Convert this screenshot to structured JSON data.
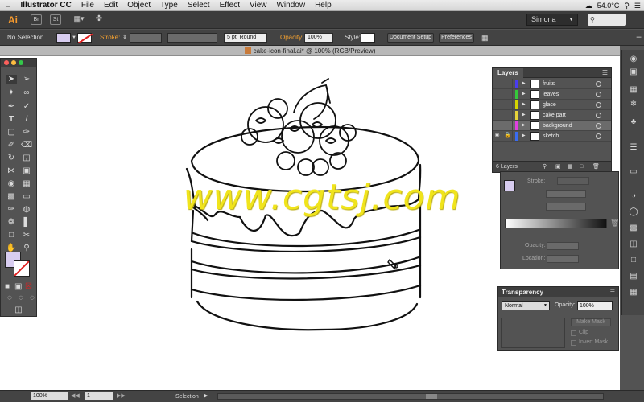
{
  "menubar": {
    "apple": "",
    "app": "Illustrator CC",
    "items": [
      "File",
      "Edit",
      "Object",
      "Type",
      "Select",
      "Effect",
      "View",
      "Window",
      "Help"
    ],
    "temp": "54.0°C"
  },
  "appbar": {
    "logo": "Ai",
    "bridge": "Br",
    "stock": "St",
    "workspace": "Simona"
  },
  "control": {
    "selection": "No Selection",
    "stroke_label": "Stroke:",
    "brush": "5 pt. Round",
    "opacity_label": "Opacity:",
    "opacity": "100%",
    "style_label": "Style:",
    "doc_setup": "Document Setup",
    "preferences": "Preferences"
  },
  "document": {
    "tab_title": "cake-icon-final.ai* @ 100% (RGB/Preview)"
  },
  "layers": {
    "tab": "Layers",
    "count": "6 Layers",
    "items": [
      {
        "name": "fruits",
        "color": "#4a3cf0"
      },
      {
        "name": "leaves",
        "color": "#36c83a"
      },
      {
        "name": "glace",
        "color": "#d4d400"
      },
      {
        "name": "cake part",
        "color": "#e7d33a"
      },
      {
        "name": "background",
        "color": "#e040e0"
      },
      {
        "name": "sketch",
        "color": "#3a6cf0"
      }
    ]
  },
  "stroke_panel": {
    "stroke_label": "Stroke:",
    "opacity_label": "Opacity:",
    "location_label": "Location:"
  },
  "transparency": {
    "tab": "Transparency",
    "mode": "Normal",
    "opacity_label": "Opacity:",
    "opacity": "100%",
    "make_mask": "Make Mask",
    "clip": "Clip",
    "invert_mask": "Invert Mask"
  },
  "status": {
    "zoom": "100%",
    "page": "1",
    "mode": "Selection"
  },
  "watermark": "www.cgtsj.com",
  "colors": {
    "accent": "#f79a2d",
    "fill_swatch": "#d8cdf0"
  }
}
